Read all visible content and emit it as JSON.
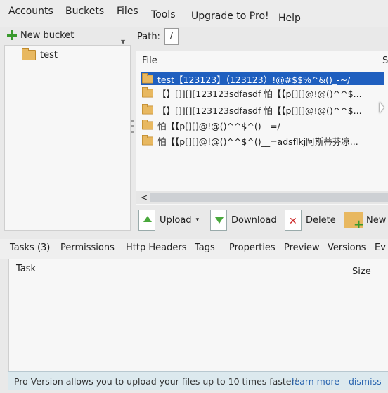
{
  "menu": {
    "accounts": "Accounts",
    "buckets": "Buckets",
    "files": "Files",
    "tools": "Tools",
    "upgrade": "Upgrade to Pro!",
    "help": "Help"
  },
  "left": {
    "new_bucket": "New bucket",
    "buckets": [
      {
        "name": "test"
      }
    ]
  },
  "path": {
    "label": "Path:",
    "value": "/"
  },
  "file_list": {
    "header": "File",
    "header_right": "S",
    "rows": [
      {
        "name": "test【123123】（123123）!@#$$%^&()_-~/",
        "selected": true
      },
      {
        "name": "【】[]][][123123sdfasdf 怕【【p[][]@!@()^^$...",
        "selected": false
      },
      {
        "name": "【】[]][][123123sdfasdf 怕【【p[][]@!@()^^$...",
        "selected": false
      },
      {
        "name": "怕【【p[][]@!@()^^$^()__=/",
        "selected": false
      },
      {
        "name": "怕【【p[][]@!@()^^$^()__=adsflkj阿斯蒂芬凉...",
        "selected": false
      }
    ],
    "scroll_left": "<"
  },
  "toolbar": {
    "upload": "Upload",
    "upload_menu": "▾",
    "download": "Download",
    "delete": "Delete",
    "new": "New"
  },
  "tabs": [
    {
      "label": "Tasks (3)"
    },
    {
      "label": "Permissions"
    },
    {
      "label": "Http Headers"
    },
    {
      "label": "Tags"
    },
    {
      "label": "Properties"
    },
    {
      "label": "Preview"
    },
    {
      "label": "Versions"
    },
    {
      "label": "Ev"
    }
  ],
  "tasks": {
    "col_task": "Task",
    "col_size": "Size"
  },
  "status": {
    "text": "Pro Version allows you to upload your files up to 10 times faster!",
    "learn_more": "learn more",
    "dismiss": "dismiss"
  },
  "colors": {
    "selection": "#1f5fbf",
    "folder": "#e8b860",
    "status_bar": "#dce9ee",
    "link": "#2c66b0"
  }
}
